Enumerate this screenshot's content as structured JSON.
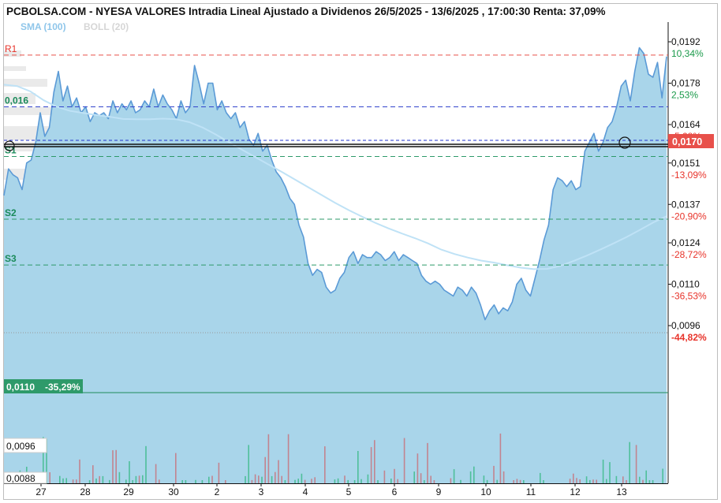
{
  "title": "PCBOLSA.COM - NYESA VALORES Intradia Lineal Ajustado a Dividenos 26/5/2025 - 13/6/2025 , 17:00:30 Renta: 37,09%",
  "legend": {
    "sma": "SMA (100)",
    "boll": "BOLL (20)"
  },
  "colors": {
    "area": "#a9d5ea",
    "line": "#5b9ad6",
    "sma": "#bfe2f6",
    "resistance": "#e8504a",
    "support": "#2e9a6a",
    "current": "#e8332a"
  },
  "chart_data": {
    "type": "area",
    "ylim": [
      0.0088,
      0.0198
    ],
    "x_labels": [
      "27",
      "28",
      "29",
      "30",
      "2",
      "3",
      "4",
      "5",
      "6",
      "9",
      "10",
      "11",
      "12",
      "13"
    ],
    "y_ticks": [
      {
        "price": "0,0192",
        "pct": "10,34%"
      },
      {
        "price": "0,0178",
        "pct": "2,53%"
      },
      {
        "price": "0,0164",
        "pct": "-5,28%"
      },
      {
        "price": "0,0151",
        "pct": "-13,09%"
      },
      {
        "price": "0,0137",
        "pct": "-20,90%"
      },
      {
        "price": "0,0124",
        "pct": "-28,72%"
      },
      {
        "price": "0,0110",
        "pct": "-36,53%"
      },
      {
        "price": "0,0096",
        "pct": "-44,82%"
      }
    ],
    "levels": [
      {
        "label": "R1",
        "value": 0.01875,
        "kind": "resistance"
      },
      {
        "label": "0,016",
        "value": 0.017,
        "kind": "pivot"
      },
      {
        "label": "S1",
        "value": 0.01532,
        "kind": "support"
      },
      {
        "label": "S2",
        "value": 0.0132,
        "kind": "support"
      },
      {
        "label": "S3",
        "value": 0.01165,
        "kind": "support"
      }
    ],
    "current_price": {
      "value": 0.017,
      "label": "0,0170"
    },
    "reference_line": {
      "value": 0.011,
      "price": "0,0110",
      "pct": "-35,29%"
    },
    "bottom_labels": [
      "0,0096",
      "0,0088"
    ],
    "series": [
      {
        "type": "price",
        "values": [
          0.014,
          0.0149,
          0.0147,
          0.0146,
          0.0142,
          0.0151,
          0.0152,
          0.0158,
          0.0168,
          0.016,
          0.0163,
          0.0175,
          0.0182,
          0.0172,
          0.0177,
          0.017,
          0.0173,
          0.0168,
          0.017,
          0.0165,
          0.0168,
          0.0167,
          0.0168,
          0.0166,
          0.0172,
          0.0168,
          0.0171,
          0.0169,
          0.0172,
          0.0168,
          0.0169,
          0.0172,
          0.017,
          0.0176,
          0.017,
          0.0174,
          0.0171,
          0.0169,
          0.0166,
          0.0172,
          0.0168,
          0.017,
          0.0184,
          0.0178,
          0.0171,
          0.0178,
          0.0178,
          0.0169,
          0.0172,
          0.0168,
          0.0166,
          0.0168,
          0.0163,
          0.0165,
          0.0159,
          0.0157,
          0.0161,
          0.0155,
          0.0157,
          0.0152,
          0.0148,
          0.0146,
          0.0143,
          0.0139,
          0.0137,
          0.013,
          0.0126,
          0.0117,
          0.0113,
          0.0115,
          0.0114,
          0.0109,
          0.0107,
          0.0108,
          0.0112,
          0.0114,
          0.0119,
          0.0121,
          0.0117,
          0.012,
          0.0119,
          0.0119,
          0.0121,
          0.012,
          0.0118,
          0.0119,
          0.0121,
          0.0118,
          0.012,
          0.0119,
          0.0118,
          0.0117,
          0.0113,
          0.0111,
          0.011,
          0.0111,
          0.011,
          0.0108,
          0.0107,
          0.0106,
          0.0109,
          0.0108,
          0.0106,
          0.0109,
          0.0107,
          0.0103,
          0.0098,
          0.0101,
          0.0103,
          0.01,
          0.0102,
          0.0101,
          0.0104,
          0.011,
          0.0112,
          0.0108,
          0.0106,
          0.0112,
          0.0118,
          0.0125,
          0.013,
          0.0142,
          0.0146,
          0.0145,
          0.0143,
          0.0145,
          0.0142,
          0.0143,
          0.0155,
          0.0158,
          0.0161,
          0.0155,
          0.0158,
          0.0163,
          0.0165,
          0.017,
          0.0177,
          0.0179,
          0.0172,
          0.0182,
          0.019,
          0.0188,
          0.0181,
          0.018,
          0.0185,
          0.0173,
          0.0187
        ]
      },
      {
        "type": "sma",
        "values": [
          0.01775,
          0.0177,
          0.01752,
          0.01722,
          0.017,
          0.01686,
          0.01679,
          0.01672,
          0.01666,
          0.01659,
          0.01658,
          0.01658,
          0.0166,
          0.01658,
          0.01648,
          0.0163,
          0.01606,
          0.0158,
          0.01554,
          0.01529,
          0.01504,
          0.01479,
          0.01453,
          0.01427,
          0.01401,
          0.01375,
          0.01351,
          0.01329,
          0.01308,
          0.01289,
          0.01272,
          0.01256,
          0.01238,
          0.01217,
          0.01202,
          0.0119,
          0.0118,
          0.01173,
          0.01164,
          0.01156,
          0.01151,
          0.01152,
          0.01162,
          0.01179,
          0.01197,
          0.01217,
          0.01238,
          0.0126,
          0.01284,
          0.01309,
          0.0133
        ]
      }
    ]
  }
}
